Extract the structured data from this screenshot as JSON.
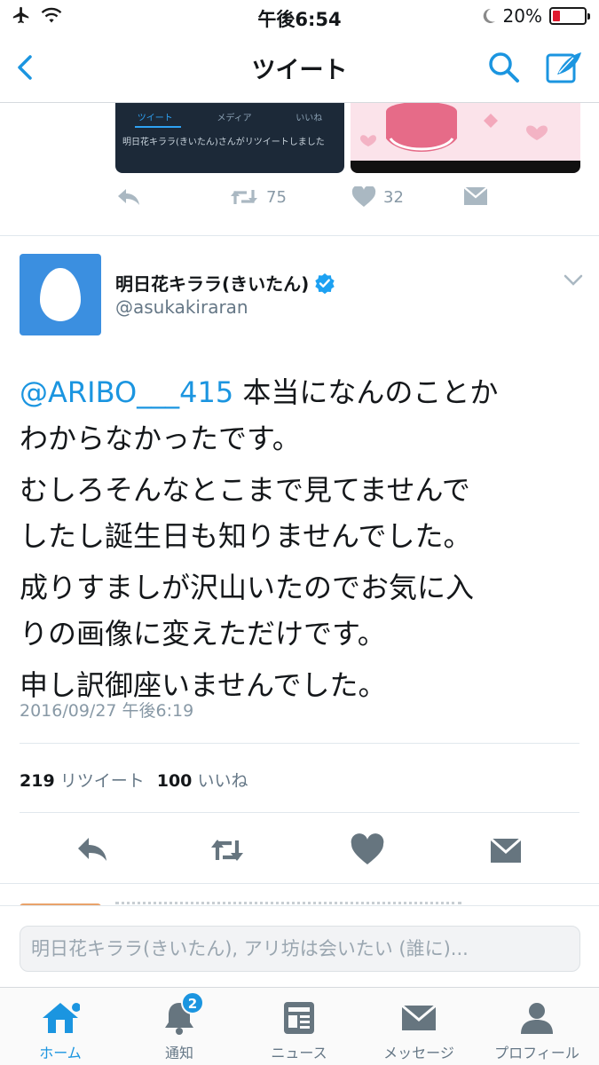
{
  "status_bar": {
    "time": "午後6:54",
    "battery_percent": "20%",
    "battery_level": 0.2
  },
  "nav": {
    "title": "ツイート"
  },
  "prev_tweet": {
    "thumb_tabs": [
      "ツイート",
      "メディア",
      "いいね"
    ],
    "thumb_text": "明日花キララ(きいたん)さんがリツイートしました",
    "retweet_count": "75",
    "like_count": "32"
  },
  "tweet": {
    "user_name": "明日花キララ(きいたん)",
    "handle": "@asukakiraran",
    "mention": "@ARIBO___415",
    "line1": " 本当になんのことか",
    "line2": "わからなかったです。",
    "line3": "むしろそんなとこまで見てませんで",
    "line4": "したし誕生日も知りませんでした。",
    "line5": "成りすましが沢山いたのでお気に入",
    "line6": "りの画像に変えただけです。",
    "line7": "申し訳御座いませんでした。",
    "timestamp": "2016/09/27 午後6:19",
    "retweet_count": "219",
    "retweet_label": "リツイート",
    "like_count": "100",
    "like_label": "いいね"
  },
  "reply": {
    "placeholder": "明日花キララ(きいたん), アリ坊は会いたい (誰に)..."
  },
  "tab_bar": {
    "home": "ホーム",
    "notifications": "通知",
    "notifications_badge": "2",
    "news": "ニュース",
    "messages": "メッセージ",
    "profile": "プロフィール"
  },
  "colors": {
    "accent": "#1b95e0",
    "verified": "#1da1f2",
    "icon_gray": "#8899a6",
    "icon_dark": "#66757f"
  }
}
